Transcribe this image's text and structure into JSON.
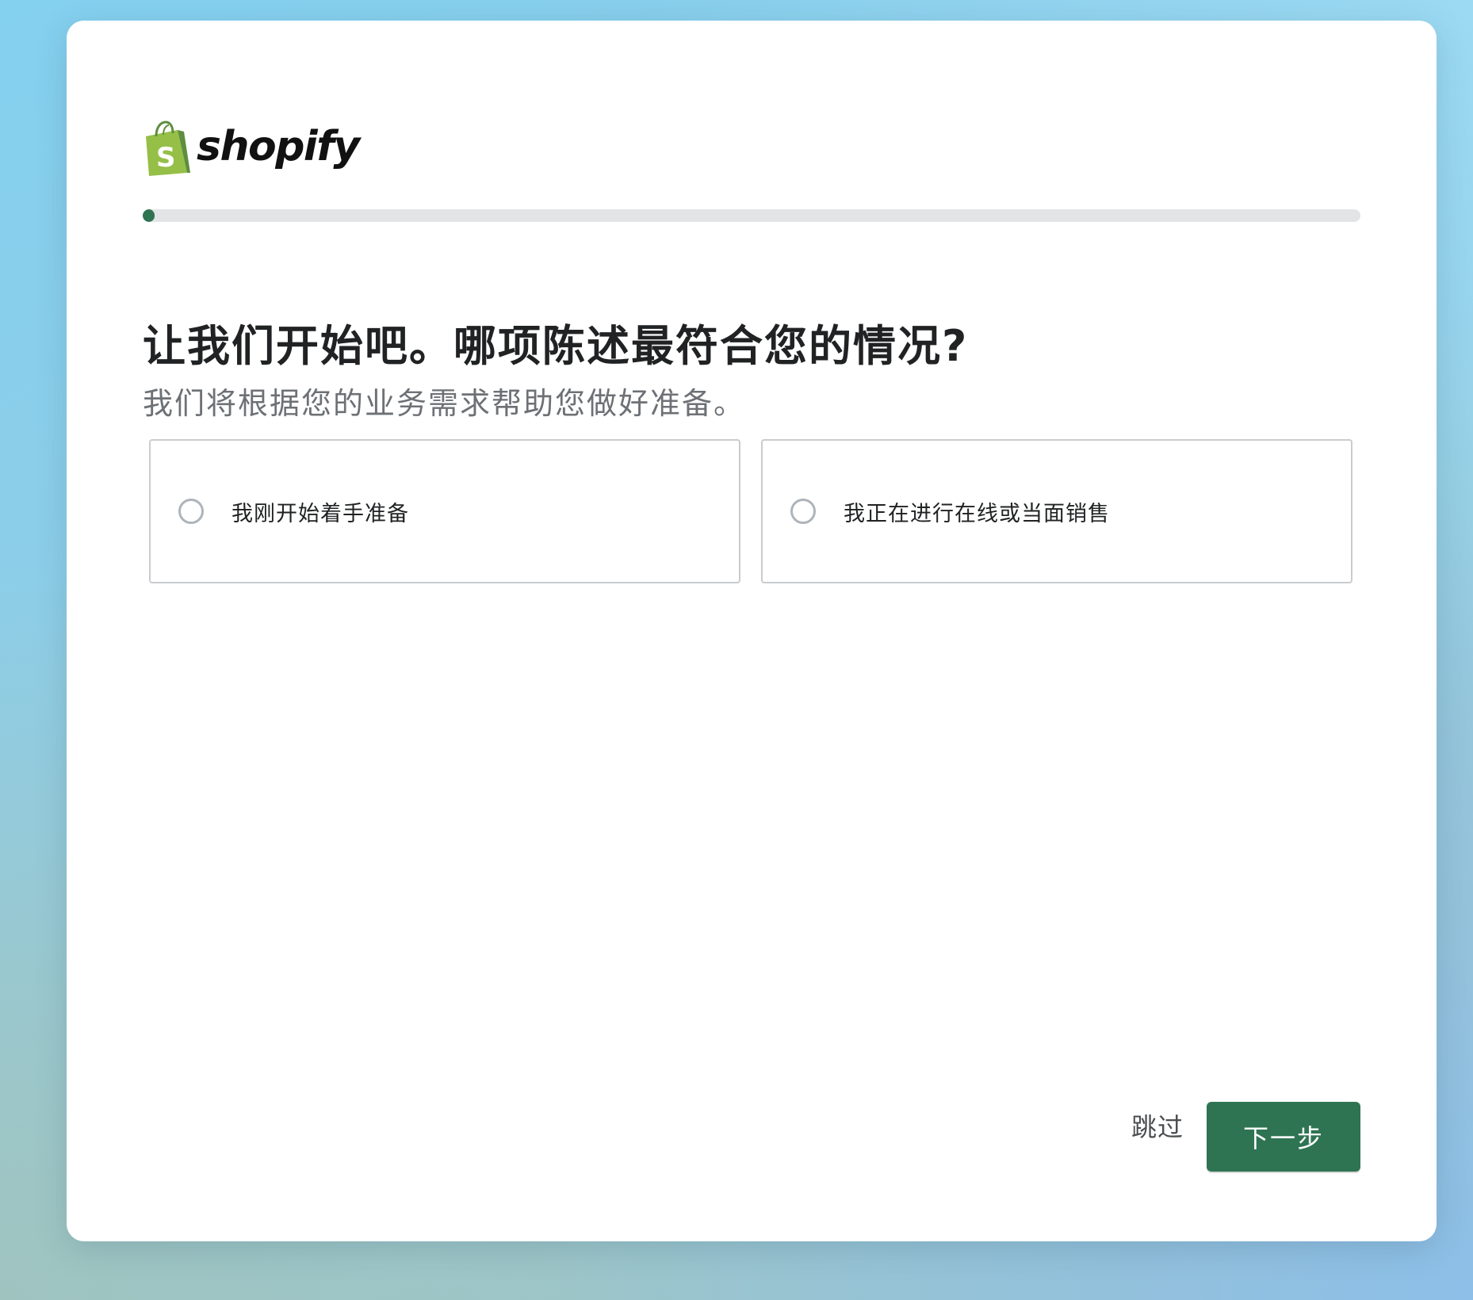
{
  "brand": {
    "logo_text": "shopify",
    "colors": {
      "primary_green": "#2e7453",
      "logo_bag_green": "#95bf47",
      "logo_bag_dark": "#5e8e3e"
    }
  },
  "progress": {
    "value_percent": 1
  },
  "question": {
    "title": "让我们开始吧。哪项陈述最符合您的情况?",
    "subtitle": "我们将根据您的业务需求帮助您做好准备。"
  },
  "options": [
    {
      "label": "我刚开始着手准备",
      "selected": false
    },
    {
      "label": "我正在进行在线或当面销售",
      "selected": false
    }
  ],
  "footer": {
    "skip_label": "跳过",
    "next_label": "下一步"
  }
}
